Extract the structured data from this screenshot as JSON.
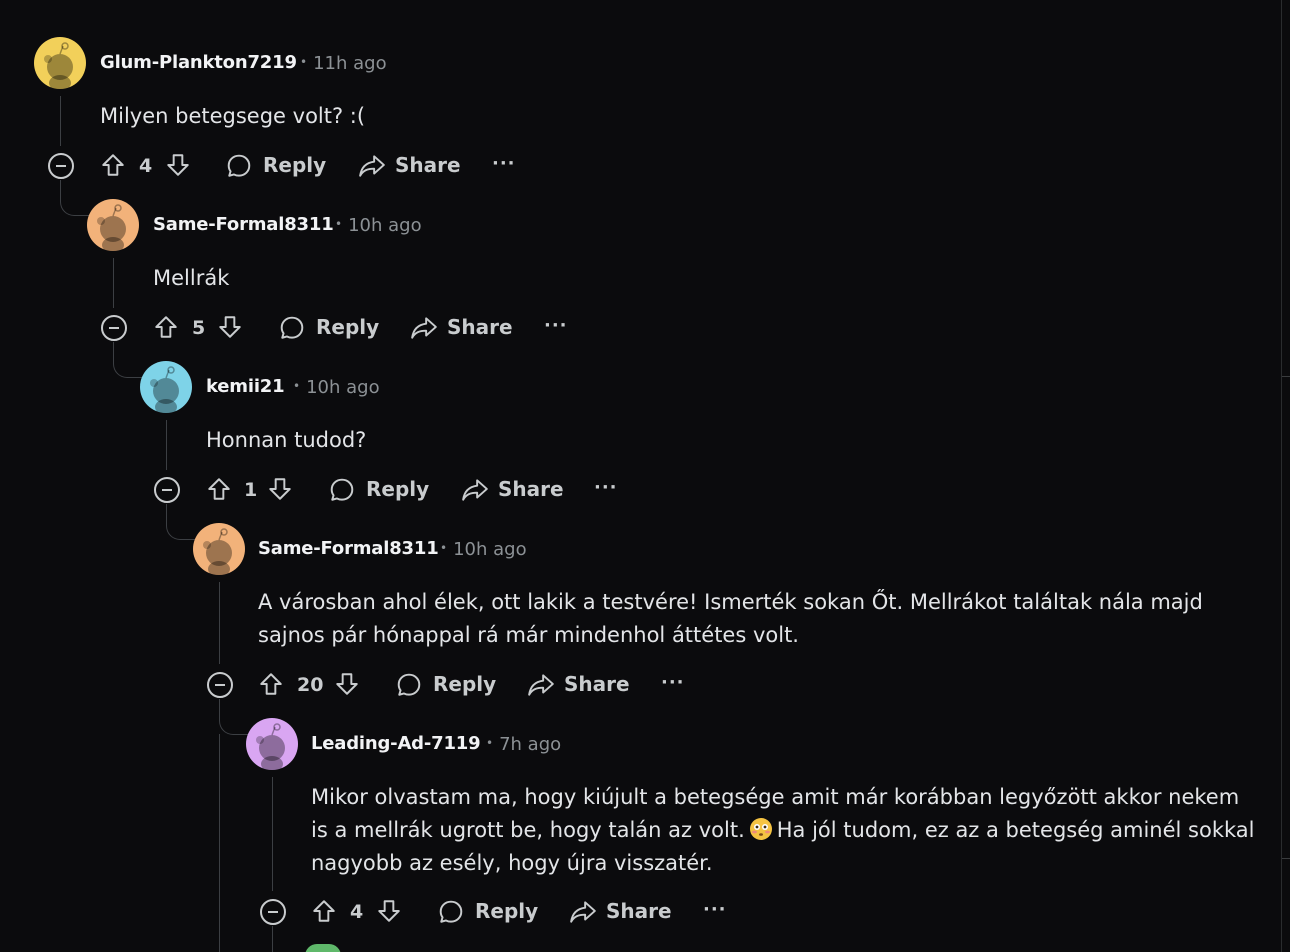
{
  "comments": [
    {
      "author": "Glum-Plankton7219",
      "time": "11h ago",
      "body": [
        "Milyen betegsege volt? :("
      ],
      "votes": "4",
      "avatar_color": "#f2d05a",
      "reply_label": "Reply",
      "share_label": "Share",
      "more_label": "···"
    },
    {
      "author": "Same-Formal8311",
      "time": "10h ago",
      "body": [
        "Mellrák"
      ],
      "votes": "5",
      "avatar_color": "#f2b27a",
      "reply_label": "Reply",
      "share_label": "Share",
      "more_label": "···"
    },
    {
      "author": "kemii21",
      "time": "10h ago",
      "body": [
        "Honnan tudod?"
      ],
      "votes": "1",
      "avatar_color": "#7ed3e8",
      "reply_label": "Reply",
      "share_label": "Share",
      "more_label": "···"
    },
    {
      "author": "Same-Formal8311",
      "time": "10h ago",
      "body": [
        "A városban ahol élek, ott lakik a testvére! Ismerték sokan Őt. Mellrákot találtak nála majd",
        "sajnos pár hónappal rá már mindenhol áttétes volt."
      ],
      "votes": "20",
      "avatar_color": "#f2b27a",
      "reply_label": "Reply",
      "share_label": "Share",
      "more_label": "···"
    },
    {
      "author": "Leading-Ad-7119",
      "time": "7h ago",
      "body": [
        "Mikor olvastam ma, hogy kiújult a betegsége amit már korábban legyőzött akkor nekem",
        "is a mellrák ugrott be, hogy talán az volt.",
        "Ha jól tudom, ez az a betegség aminél sokkal",
        "nagyobb az esély, hogy újra visszatér."
      ],
      "votes": "4",
      "avatar_color": "#d9a6f2",
      "reply_label": "Reply",
      "share_label": "Share",
      "more_label": "···",
      "emoji": "flushed-face-emoji"
    }
  ],
  "colors": {
    "background": "#0b0b0d",
    "thread_line": "#3c3f43",
    "text": "#e3e5e8",
    "muted": "#8c9195"
  }
}
